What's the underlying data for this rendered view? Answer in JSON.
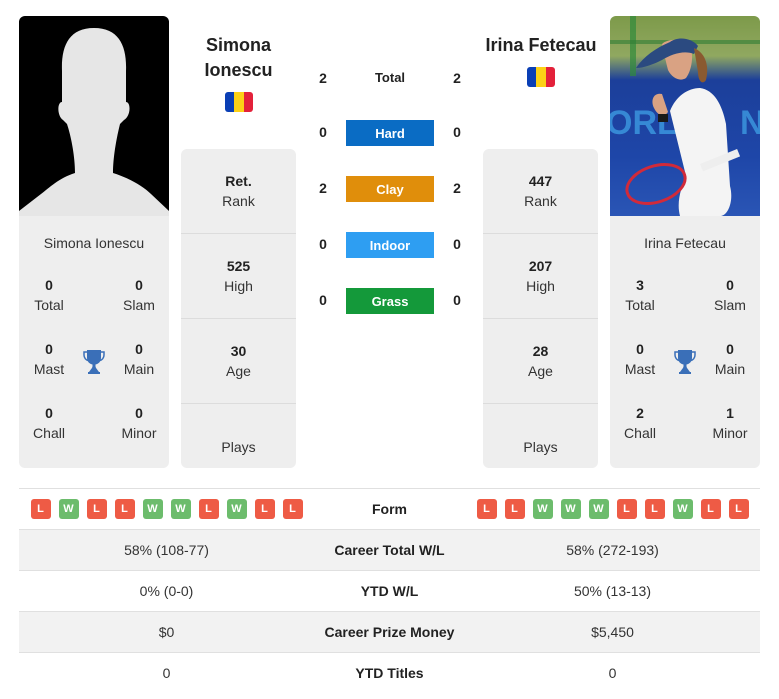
{
  "player_left": {
    "name_heading": "Simona Ionescu",
    "card_name": "Simona Ionescu",
    "photo": "silhouette-placeholder",
    "flag": "romania-flag",
    "info": [
      {
        "value": "Ret.",
        "label": "Rank"
      },
      {
        "value": "525",
        "label": "High"
      },
      {
        "value": "30",
        "label": "Age"
      },
      {
        "value": "",
        "label": "Plays"
      }
    ],
    "titles": {
      "total": {
        "value": "0",
        "label": "Total"
      },
      "slam": {
        "value": "0",
        "label": "Slam"
      },
      "mast": {
        "value": "0",
        "label": "Mast"
      },
      "main": {
        "value": "0",
        "label": "Main"
      },
      "chall": {
        "value": "0",
        "label": "Chall"
      },
      "minor": {
        "value": "0",
        "label": "Minor"
      }
    },
    "form": [
      "L",
      "W",
      "L",
      "L",
      "W",
      "W",
      "L",
      "W",
      "L",
      "L"
    ]
  },
  "player_right": {
    "name_heading": "Irina Fetecau",
    "card_name": "Irina Fetecau",
    "photo": "player-photo",
    "flag": "romania-flag",
    "info": [
      {
        "value": "447",
        "label": "Rank"
      },
      {
        "value": "207",
        "label": "High"
      },
      {
        "value": "28",
        "label": "Age"
      },
      {
        "value": "",
        "label": "Plays"
      }
    ],
    "titles": {
      "total": {
        "value": "3",
        "label": "Total"
      },
      "slam": {
        "value": "0",
        "label": "Slam"
      },
      "mast": {
        "value": "0",
        "label": "Mast"
      },
      "main": {
        "value": "0",
        "label": "Main"
      },
      "chall": {
        "value": "2",
        "label": "Chall"
      },
      "minor": {
        "value": "1",
        "label": "Minor"
      }
    },
    "form": [
      "L",
      "L",
      "W",
      "W",
      "W",
      "L",
      "L",
      "W",
      "L",
      "L"
    ]
  },
  "h2h": [
    {
      "label": "Total",
      "left": "2",
      "right": "2",
      "color": null
    },
    {
      "label": "Hard",
      "left": "0",
      "right": "0",
      "color": "#0a6cc4"
    },
    {
      "label": "Clay",
      "left": "2",
      "right": "2",
      "color": "#e08e0b"
    },
    {
      "label": "Indoor",
      "left": "0",
      "right": "0",
      "color": "#2e9ef2"
    },
    {
      "label": "Grass",
      "left": "0",
      "right": "0",
      "color": "#14993a"
    }
  ],
  "stats": {
    "form_label": "Form",
    "rows": [
      {
        "label": "Career Total W/L",
        "left": "58% (108-77)",
        "right": "58% (272-193)"
      },
      {
        "label": "YTD W/L",
        "left": "0% (0-0)",
        "right": "50% (13-13)"
      },
      {
        "label": "Career Prize Money",
        "left": "$0",
        "right": "$5,450"
      },
      {
        "label": "YTD Titles",
        "left": "0",
        "right": "0"
      }
    ]
  },
  "colors": {
    "loss": "#ee5b45",
    "win": "#6cbc6c",
    "trophy": "#3a6fb8"
  }
}
